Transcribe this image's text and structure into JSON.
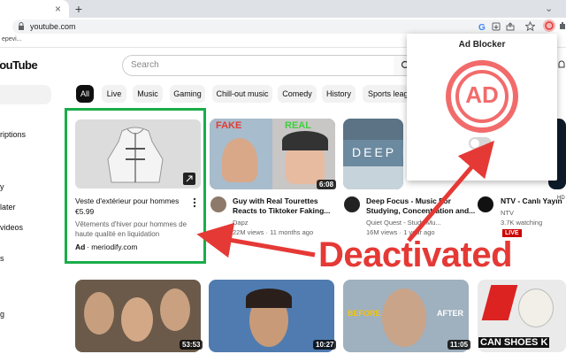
{
  "browser": {
    "tab_close": "×",
    "new_tab": "+",
    "tab_menu": "⌄",
    "url": "youtube.com",
    "bookmark": "epevi..."
  },
  "youtube": {
    "logo_text": "YouTube",
    "search_placeholder": "Search",
    "sidebar": [
      "",
      "",
      "riptions",
      "",
      "y",
      "later",
      "videos",
      "s",
      "",
      "g"
    ],
    "chips": [
      "All",
      "Live",
      "Music",
      "Gaming",
      "Chill-out music",
      "Comedy",
      "History",
      "Sports leag"
    ]
  },
  "ad_card": {
    "title": "Veste d'extérieur pour hommes",
    "price": "€5.99",
    "description": "Vêtements d'hiver pour hommes de haute qualité en liquidation",
    "label": "Ad",
    "domain": "· meriodify.com"
  },
  "videos": [
    {
      "title_line1": "Guy with Real Tourettes",
      "title_line2": "Reacts to Tiktoker Faking...",
      "channel": "Dapz",
      "meta": "22M views · 11 months ago",
      "duration": "6:08",
      "overlay_fake": "FAKE",
      "overlay_real": "REAL"
    },
    {
      "title_line1": "Deep Focus - Music For",
      "title_line2": "Studying, Concentration and...",
      "channel": "Quiet Quest - Study Mu...",
      "meta": "16M views · 1 year ago",
      "thumb_text": "DEEP F"
    },
    {
      "title_line1": "NTV - Canlı Yayın",
      "title_line1_suffix": "HD",
      "channel": "NTV",
      "meta": "3.7K watching",
      "live": "LIVE"
    }
  ],
  "row2": [
    {
      "duration": "53:53"
    },
    {
      "duration": "10:27"
    },
    {
      "duration": "11:05",
      "before": "BEFORE",
      "after": "AFTER"
    },
    {
      "overlay": "CAN SHOES K"
    }
  ],
  "popup": {
    "title": "Ad Blocker",
    "logo_text": "AD"
  },
  "annotation": {
    "text": "Deactivated"
  },
  "colors": {
    "highlight_green": "#1bad4a",
    "annotation_red": "#e53935"
  }
}
